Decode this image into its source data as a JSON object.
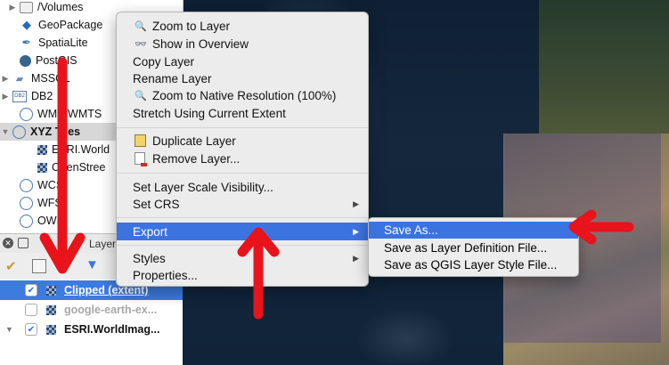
{
  "browser": {
    "items": [
      {
        "label": "/Volumes",
        "icon": "folder-icon"
      },
      {
        "label": "GeoPackage",
        "icon": "geopackage-icon"
      },
      {
        "label": "SpatiaLite",
        "icon": "spatialite-icon"
      },
      {
        "label": "PostGIS",
        "icon": "postgis-icon"
      },
      {
        "label": "MSSQL",
        "icon": "mssql-icon"
      },
      {
        "label": "DB2",
        "icon": "db2-icon"
      },
      {
        "label": "WMS/WMTS",
        "icon": "globe-icon"
      },
      {
        "label": "XYZ Tiles",
        "icon": "globe-icon"
      },
      {
        "label": "ESRI.World",
        "icon": "tile-icon"
      },
      {
        "label": "OpenStree",
        "icon": "tile-icon"
      },
      {
        "label": "WCS",
        "icon": "globe-icon"
      },
      {
        "label": "WFS",
        "icon": "globe-icon"
      },
      {
        "label": "OWS",
        "icon": "globe-icon"
      }
    ]
  },
  "layers": {
    "title": "Layers",
    "rows": [
      {
        "label": "Clipped (extent)",
        "checked": true,
        "selected": true
      },
      {
        "label": "google-earth-ex...",
        "checked": false,
        "selected": false
      },
      {
        "label": "ESRI.WorldImag...",
        "checked": true,
        "selected": false
      }
    ]
  },
  "menu": {
    "group1": [
      {
        "label": "Zoom to Layer",
        "icon": "zoom-icon"
      },
      {
        "label": "Show in Overview",
        "icon": "overview-icon"
      },
      {
        "label": "Copy Layer",
        "icon": ""
      },
      {
        "label": "Rename Layer",
        "icon": ""
      },
      {
        "label": "Zoom to Native Resolution (100%)",
        "icon": "native-resolution-icon"
      },
      {
        "label": "Stretch Using Current Extent",
        "icon": ""
      }
    ],
    "group2": [
      {
        "label": "Duplicate Layer",
        "icon": "duplicate-icon"
      },
      {
        "label": "Remove Layer...",
        "icon": "remove-icon"
      }
    ],
    "group3": [
      {
        "label": "Set Layer Scale Visibility...",
        "icon": ""
      },
      {
        "label": "Set CRS",
        "icon": "",
        "submenu": true
      }
    ],
    "export": {
      "label": "Export",
      "submenu": true
    },
    "group4": [
      {
        "label": "Styles",
        "icon": "",
        "submenu": true
      },
      {
        "label": "Properties...",
        "icon": ""
      }
    ],
    "submenu_arrow": "▶"
  },
  "export_submenu": [
    {
      "label": "Save As..."
    },
    {
      "label": "Save as Layer Definition File..."
    },
    {
      "label": "Save as QGIS Layer Style File..."
    }
  ],
  "colors": {
    "highlight": "#3b73e0",
    "arrow": "#e8131b"
  }
}
